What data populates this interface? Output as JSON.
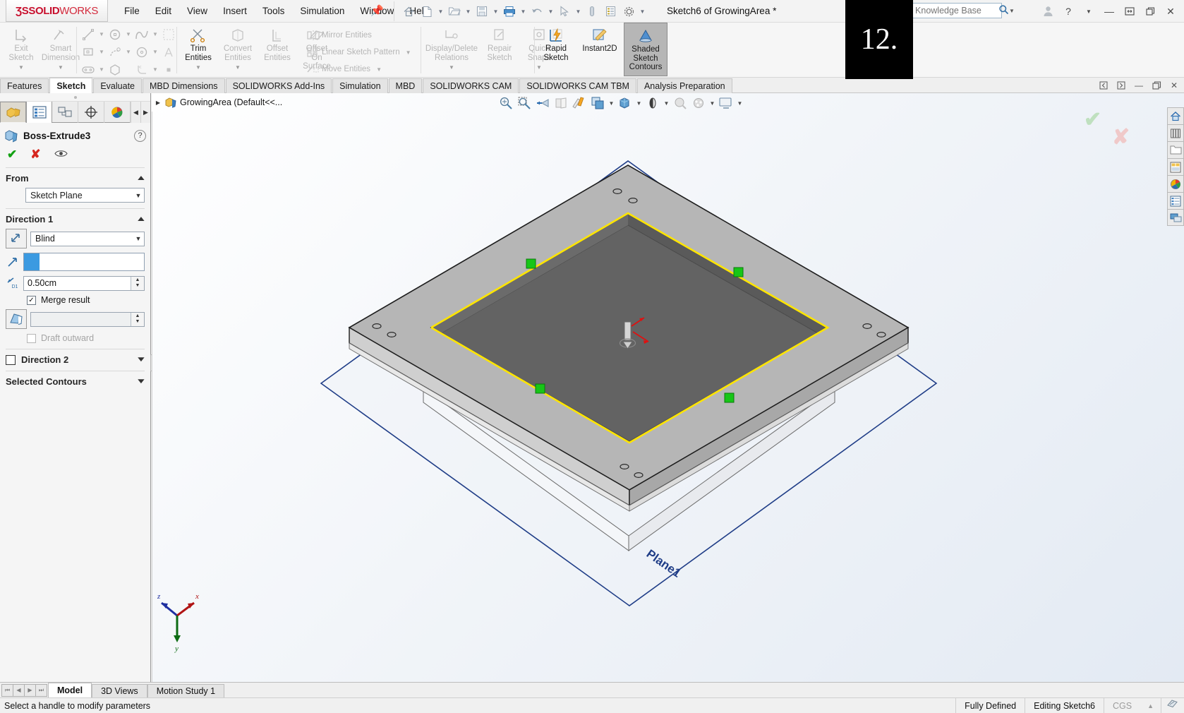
{
  "app": {
    "brand_ds": "ƷS",
    "brand_solid": "SOLID",
    "brand_works": "WORKS",
    "document_title": "Sketch6 of GrowingArea *"
  },
  "menubar": {
    "items": [
      "File",
      "Edit",
      "View",
      "Insert",
      "Tools",
      "Simulation",
      "Window",
      "Help"
    ],
    "pin_icon": "pushpin-icon",
    "quick_access": [
      {
        "name": "home-icon",
        "glyph": "⌂"
      },
      {
        "name": "new-document-icon",
        "glyph": "὜B"
      },
      {
        "name": "open-icon",
        "glyph": "὜1"
      },
      {
        "name": "save-icon",
        "glyph": "὚B"
      },
      {
        "name": "print-icon",
        "glyph": "⎙"
      },
      {
        "name": "undo-icon",
        "glyph": "↶"
      },
      {
        "name": "select-cursor-icon",
        "glyph": "➤"
      },
      {
        "name": "rebuild-icon",
        "glyph": "⬛"
      },
      {
        "name": "options-list-icon",
        "glyph": "☰"
      },
      {
        "name": "settings-gear-icon",
        "glyph": "⚙"
      }
    ]
  },
  "search": {
    "placeholder": "Search Knowledge Base",
    "value": ""
  },
  "window_controls": {
    "user": "account-icon",
    "help": "?",
    "minimize": "—",
    "restore": "❐",
    "maximize": "❐",
    "close": "✕"
  },
  "overlay": {
    "label": "12."
  },
  "ribbon": {
    "groups": [
      {
        "name": "sketch-exit-group",
        "buttons": [
          {
            "label_line1": "Exit",
            "label_line2": "Sketch",
            "icon": "exit-sketch-icon",
            "enabled": false,
            "dropdown": true
          },
          {
            "label_line1": "Smart",
            "label_line2": "Dimension",
            "icon": "smart-dimension-icon",
            "enabled": false,
            "dropdown": true
          }
        ]
      },
      {
        "name": "sketch-entities-group",
        "icons": [
          "line-icon",
          "circle-icon",
          "spline-icon",
          "rectangle-grid-icon",
          "corner-rectangle-icon",
          "arc-icon",
          "perimeter-circle-icon",
          "text-icon",
          "slot-icon",
          "polygon-icon",
          "fillet-icon",
          "point-icon"
        ]
      },
      {
        "name": "modify-group",
        "buttons": [
          {
            "label_line1": "Trim",
            "label_line2": "Entities",
            "icon": "trim-entities-icon",
            "enabled": true,
            "dropdown": true
          },
          {
            "label_line1": "Convert",
            "label_line2": "Entities",
            "icon": "convert-entities-icon",
            "enabled": false,
            "dropdown": true
          },
          {
            "label_line1": "Offset",
            "label_line2": "Entities",
            "icon": "offset-entities-icon",
            "enabled": false
          },
          {
            "label_line1": "Offset",
            "label_line2": "On",
            "label_line3": "Surface",
            "icon": "offset-on-surface-icon",
            "enabled": false
          }
        ]
      },
      {
        "name": "pattern-group",
        "items": [
          {
            "label": "Mirror Entities",
            "icon": "mirror-entities-icon"
          },
          {
            "label": "Linear Sketch Pattern",
            "icon": "linear-sketch-pattern-icon",
            "dropdown": true
          },
          {
            "label": "Move Entities",
            "icon": "move-entities-icon",
            "dropdown": true
          }
        ]
      },
      {
        "name": "relations-group",
        "buttons": [
          {
            "label_line1": "Display/Delete",
            "label_line2": "Relations",
            "icon": "display-delete-relations-icon",
            "enabled": false,
            "dropdown": true
          },
          {
            "label_line1": "Repair",
            "label_line2": "Sketch",
            "icon": "repair-sketch-icon",
            "enabled": false
          },
          {
            "label_line1": "Quick",
            "label_line2": "Snaps",
            "icon": "quick-snaps-icon",
            "enabled": false,
            "dropdown": true
          }
        ]
      },
      {
        "name": "tools-group",
        "buttons": [
          {
            "label_line1": "Rapid",
            "label_line2": "Sketch",
            "icon": "rapid-sketch-icon",
            "enabled": true
          },
          {
            "label_line1": "Instant2D",
            "label_line2": "",
            "icon": "instant2d-icon",
            "enabled": true
          },
          {
            "label_line1": "Shaded",
            "label_line2": "Sketch",
            "label_line3": "Contours",
            "icon": "shaded-sketch-contours-icon",
            "enabled": true,
            "selected": true
          }
        ]
      }
    ]
  },
  "ribbon_tabs": {
    "items": [
      {
        "label": "Features",
        "active": false
      },
      {
        "label": "Sketch",
        "active": true
      },
      {
        "label": "Evaluate",
        "active": false
      },
      {
        "label": "MBD Dimensions",
        "active": false
      },
      {
        "label": "SOLIDWORKS Add-Ins",
        "active": false
      },
      {
        "label": "Simulation",
        "active": false
      },
      {
        "label": "MBD",
        "active": false
      },
      {
        "label": "SOLIDWORKS CAM",
        "active": false
      },
      {
        "label": "SOLIDWORKS CAM TBM",
        "active": false
      },
      {
        "label": "Analysis Preparation",
        "active": false
      }
    ],
    "window_buttons": [
      "◁",
      "▷",
      "—",
      "❐",
      "✕"
    ]
  },
  "property_manager": {
    "tabs": [
      {
        "name": "feature-manager-tab",
        "icon": "feature-tree-icon",
        "active": true
      },
      {
        "name": "property-manager-tab",
        "icon": "property-list-icon",
        "active": false,
        "current": true
      },
      {
        "name": "configuration-manager-tab",
        "icon": "configuration-icon",
        "active": false
      },
      {
        "name": "dimxpert-manager-tab",
        "icon": "dimxpert-icon",
        "active": false
      },
      {
        "name": "display-manager-tab",
        "icon": "display-palette-icon",
        "active": false
      }
    ],
    "title": "Boss-Extrude3",
    "title_icon": "boss-extrude-icon",
    "help_icon": "?",
    "actions": [
      {
        "name": "accept-button",
        "glyph": "✔"
      },
      {
        "name": "cancel-button",
        "glyph": "✘"
      },
      {
        "name": "preview-button",
        "glyph": "◉"
      }
    ],
    "sections": {
      "from": {
        "title": "From",
        "condition": "Sketch Plane"
      },
      "direction1": {
        "title": "Direction 1",
        "end_condition": "Blind",
        "reverse_icon": "reverse-direction-icon",
        "direction_vector_icon": "direction-vector-icon",
        "direction_vector_value": "",
        "depth_icon": "depth-d1-icon",
        "depth_value": "0.50cm",
        "merge_result_label": "Merge result",
        "merge_result_checked": true,
        "draft_icon": "draft-angle-icon",
        "draft_value": "",
        "draft_outward_label": "Draft outward",
        "draft_outward_checked": false,
        "draft_outward_enabled": false
      },
      "direction2": {
        "title": "Direction 2",
        "checked": false
      },
      "selected_contours": {
        "title": "Selected Contours"
      }
    }
  },
  "graphics": {
    "feature_tree_root": "GrowingArea  (Default<<...",
    "root_icon": "part-icon",
    "expand_icon": "chevron-right-icon",
    "view_toolbar": [
      {
        "name": "zoom-to-fit-icon",
        "dropdown": false
      },
      {
        "name": "zoom-to-area-icon",
        "dropdown": false
      },
      {
        "name": "previous-view-icon",
        "dropdown": false
      },
      {
        "name": "section-view-icon",
        "dropdown": false
      },
      {
        "name": "view-orientation-icon",
        "dropdown": false
      },
      {
        "name": "display-style-icon",
        "dropdown": true
      },
      {
        "name": "hide-show-items-icon",
        "dropdown": true
      },
      {
        "name": "edit-appearance-icon",
        "dropdown": false
      },
      {
        "name": "apply-scene-icon",
        "dropdown": true
      },
      {
        "name": "view-settings-icon",
        "dropdown": true
      }
    ],
    "confirmation_corner": {
      "accept": "✔",
      "cancel": "✘"
    },
    "plane_label": "Plane1",
    "triad": {
      "x": "x",
      "y": "y",
      "z": "z"
    },
    "colors": {
      "plate_top": "#b3b3b3",
      "plate_top_light": "#c6c6c6",
      "recess": "#5e5e5e",
      "recess_dark": "#565656",
      "sketch_highlight": "#ffe500",
      "plane_outline": "#1f3d87",
      "relation_marker": "#12c312",
      "handle_arrow": "#e01010"
    }
  },
  "task_pane": [
    {
      "name": "solidworks-resources-icon",
      "glyph": "⌂"
    },
    {
      "name": "design-library-icon",
      "glyph": "ὍA"
    },
    {
      "name": "file-explorer-icon",
      "glyph": "὜1"
    },
    {
      "name": "view-palette-icon",
      "glyph": "▤"
    },
    {
      "name": "appearances-scenes-icon",
      "glyph": "●"
    },
    {
      "name": "custom-properties-icon",
      "glyph": "☰"
    },
    {
      "name": "solidworks-forum-icon",
      "glyph": "὞8"
    }
  ],
  "document_tabs": {
    "nav": [
      "⏮",
      "◀",
      "▶",
      "⏭"
    ],
    "items": [
      {
        "label": "Model",
        "active": true
      },
      {
        "label": "3D Views",
        "active": false
      },
      {
        "label": "Motion Study 1",
        "active": false
      }
    ]
  },
  "status_bar": {
    "message": "Select a handle to modify parameters",
    "state": "Fully Defined",
    "editing": "Editing Sketch6",
    "units": "CGS",
    "units_caret": "▲",
    "overlay_icon": "sketch-status-icon"
  }
}
